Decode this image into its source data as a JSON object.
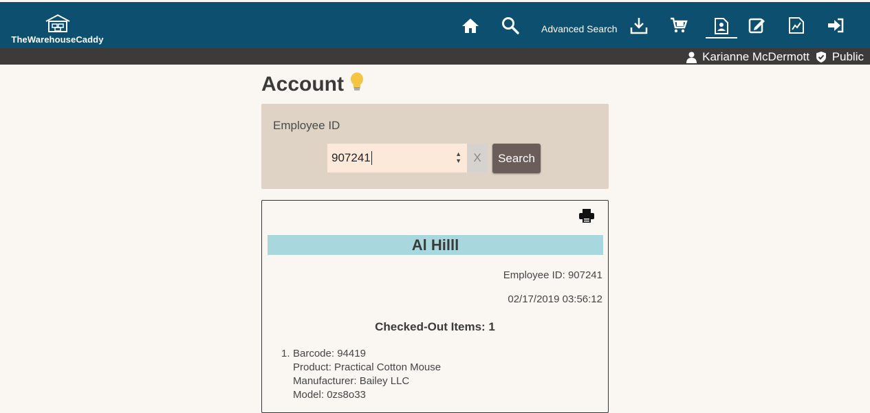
{
  "header": {
    "logo_text": "TheWarehouseCaddy",
    "advanced_search": "Advanced Search"
  },
  "user": {
    "name": "Karianne McDermott",
    "role": "Public"
  },
  "page": {
    "title": "Account"
  },
  "search": {
    "label": "Employee ID",
    "value": "907241",
    "clear_label": "X",
    "button_label": "Search"
  },
  "account": {
    "name": "Al Hilll",
    "employee_id_text": "Employee ID: 907241",
    "timestamp": "02/17/2019 03:56:12",
    "checked_out_heading": "Checked-Out Items: 1",
    "items": [
      {
        "number": "1.",
        "barcode": "Barcode: 94419",
        "product": "Product: Practical Cotton Mouse",
        "manufacturer": "Manufacturer: Bailey LLC",
        "model": "Model: 0zs8o33"
      }
    ]
  },
  "colors": {
    "header": "#0d4f6e",
    "userbar": "#3d3a3a",
    "panel": "#ded3c5",
    "name_bar": "#a8d8de",
    "search_button": "#6b5d5a"
  }
}
